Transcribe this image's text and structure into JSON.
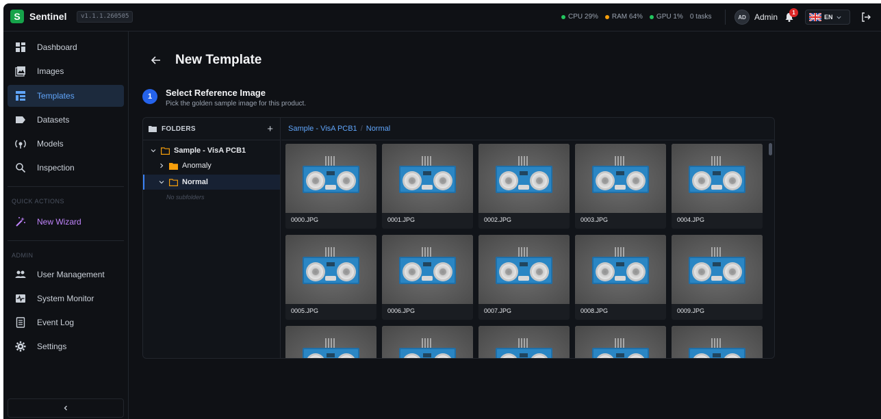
{
  "app": {
    "logo_letter": "S",
    "name": "Sentinel",
    "version": "v1.1.1.260505"
  },
  "status": {
    "cpu": "CPU 29%",
    "ram": "RAM 64%",
    "gpu": "GPU 1%",
    "tasks": "0 tasks",
    "colors": {
      "cpu": "#22c55e",
      "ram": "#f59e0b",
      "gpu": "#22c55e"
    }
  },
  "user": {
    "initials": "AD",
    "name": "Admin",
    "notifications": "1",
    "language": "EN"
  },
  "sidebar": {
    "items": [
      {
        "label": "Dashboard",
        "icon": "dashboard-icon"
      },
      {
        "label": "Images",
        "icon": "image-icon"
      },
      {
        "label": "Templates",
        "icon": "template-icon",
        "active": true
      },
      {
        "label": "Datasets",
        "icon": "tag-icon"
      },
      {
        "label": "Models",
        "icon": "model-icon"
      },
      {
        "label": "Inspection",
        "icon": "search-icon"
      }
    ],
    "quick_actions_label": "QUICK ACTIONS",
    "wizard_label": "New Wizard",
    "admin_label": "ADMIN",
    "admin_items": [
      {
        "label": "User Management",
        "icon": "users-icon"
      },
      {
        "label": "System Monitor",
        "icon": "monitor-icon"
      },
      {
        "label": "Event Log",
        "icon": "log-icon"
      },
      {
        "label": "Settings",
        "icon": "gear-icon"
      }
    ]
  },
  "page": {
    "title": "New Template",
    "step_number": "1",
    "step_title": "Select Reference Image",
    "step_subtitle": "Pick the golden sample image for this product."
  },
  "folders": {
    "header": "FOLDERS",
    "root": "Sample - VisA PCB1",
    "children": [
      "Anomaly",
      "Normal"
    ],
    "selected": "Normal",
    "empty_text": "No subfolders"
  },
  "breadcrumb": [
    "Sample - VisA PCB1",
    "Normal"
  ],
  "images": [
    "0000.JPG",
    "0001.JPG",
    "0002.JPG",
    "0003.JPG",
    "0004.JPG",
    "0005.JPG",
    "0006.JPG",
    "0007.JPG",
    "0008.JPG",
    "0009.JPG",
    "",
    "",
    "",
    "",
    ""
  ]
}
